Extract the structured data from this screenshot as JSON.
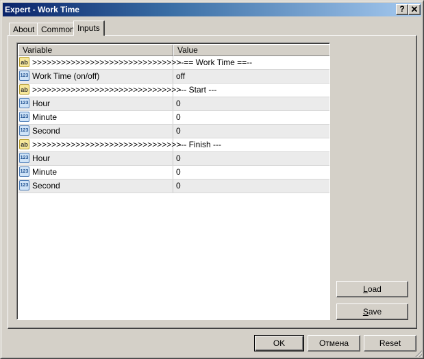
{
  "window": {
    "title": "Expert - Work Time",
    "help_button": "?",
    "close_button": "✕"
  },
  "tabs": [
    {
      "label": "About",
      "active": false
    },
    {
      "label": "Common",
      "active": false
    },
    {
      "label": "Inputs",
      "active": true
    }
  ],
  "table": {
    "columns": [
      "Variable",
      "Value"
    ],
    "rows": [
      {
        "icon": "ab",
        "icon_text": "ab",
        "variable": ">>>>>>>>>>>>>>>>>>>>>>>>>>>>>>>",
        "value": " --== Work Time ==--"
      },
      {
        "icon": "number",
        "icon_text": "123",
        "variable": "Work Time (on/off)",
        "value": "off"
      },
      {
        "icon": "ab",
        "icon_text": "ab",
        "variable": ">>>>>>>>>>>>>>>>>>>>>>>>>>>>>>>",
        "value": " --- Start ---"
      },
      {
        "icon": "number",
        "icon_text": "123",
        "variable": "Hour",
        "value": "0"
      },
      {
        "icon": "number",
        "icon_text": "123",
        "variable": "Minute",
        "value": "0"
      },
      {
        "icon": "number",
        "icon_text": "123",
        "variable": "Second",
        "value": "0"
      },
      {
        "icon": "ab",
        "icon_text": "ab",
        "variable": ">>>>>>>>>>>>>>>>>>>>>>>>>>>>>>>",
        "value": " --- Finish ---"
      },
      {
        "icon": "number",
        "icon_text": "123",
        "variable": "Hour",
        "value": "0"
      },
      {
        "icon": "number",
        "icon_text": "123",
        "variable": "Minute",
        "value": "0"
      },
      {
        "icon": "number",
        "icon_text": "123",
        "variable": "Second",
        "value": "0"
      }
    ]
  },
  "side_buttons": {
    "load": {
      "mnemonic": "L",
      "rest": "oad"
    },
    "save": {
      "mnemonic": "S",
      "rest": "ave"
    }
  },
  "footer_buttons": {
    "ok": "OK",
    "cancel": "Отмена",
    "reset": "Reset"
  }
}
